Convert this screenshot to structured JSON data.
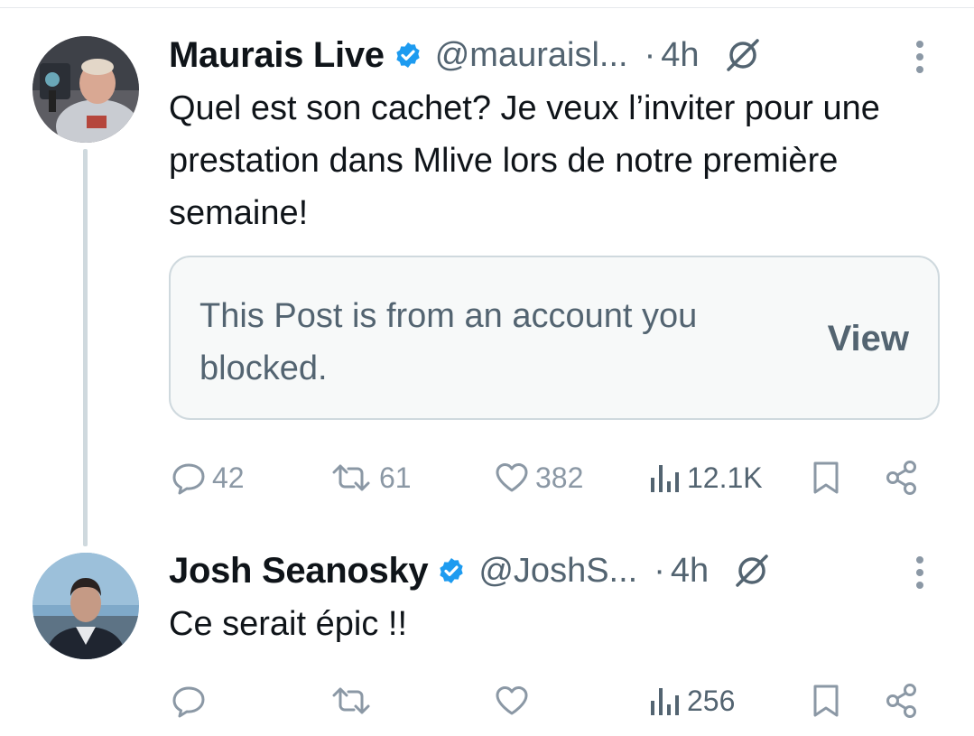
{
  "posts": [
    {
      "author": "Maurais Live",
      "handle": "@mauraisl...",
      "separator": "·",
      "time": "4h",
      "text": "Quel est son cachet? Je veux l’inviter pour une prestation dans Mlive lors de notre première semaine!",
      "quote": {
        "text": "This Post is from an account you blocked.",
        "action": "View"
      },
      "stats": {
        "replies": "42",
        "reposts": "61",
        "likes": "382",
        "views": "12.1K"
      }
    },
    {
      "author": "Josh Seanosky",
      "handle": "@JoshS...",
      "separator": "·",
      "time": "4h",
      "text": "Ce serait épic !!",
      "stats": {
        "replies": "",
        "reposts": "",
        "likes": "",
        "views": "256"
      }
    }
  ],
  "colors": {
    "verified": "#1d9bf0",
    "secondary_text": "#536471",
    "icon_gray": "#8b98a5",
    "border": "#cfd9de",
    "thread_line": "#cfd9de"
  },
  "icons": [
    "avatar",
    "verified-badge-icon",
    "grok-icon",
    "more-icon",
    "reply-icon",
    "repost-icon",
    "like-icon",
    "views-icon",
    "bookmark-icon",
    "share-icon"
  ]
}
